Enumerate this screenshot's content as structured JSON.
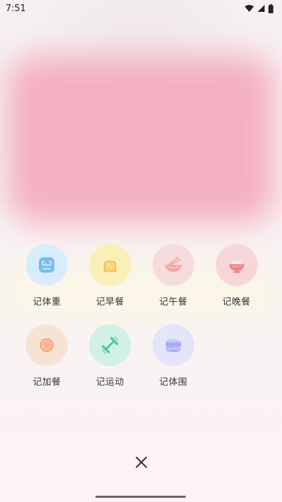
{
  "status_bar": {
    "time": "7:51",
    "icons": [
      "wifi-icon",
      "signal-icon",
      "battery-icon"
    ]
  },
  "actions": [
    {
      "label": "记体重",
      "icon": "scale-icon",
      "bg": "#d9ecfb",
      "color": "#6bb6ef"
    },
    {
      "label": "记早餐",
      "icon": "bread-icon",
      "bg": "#fbefb8",
      "color": "#f6c75c"
    },
    {
      "label": "记午餐",
      "icon": "noodle-bowl-icon",
      "bg": "#f7dcdd",
      "color": "#f2a3a4"
    },
    {
      "label": "记晚餐",
      "icon": "rice-bowl-icon",
      "bg": "#f6d6d8",
      "color": "#f28a8e"
    },
    {
      "label": "记加餐",
      "icon": "orange-slice-icon",
      "bg": "#f7e2d4",
      "color": "#f3a882"
    },
    {
      "label": "记运动",
      "icon": "dumbbell-icon",
      "bg": "#d2f0e6",
      "color": "#5fd1aa"
    },
    {
      "label": "记体围",
      "icon": "tape-measure-icon",
      "bg": "#e4e5fb",
      "color": "#a9abf2"
    }
  ],
  "close": {
    "icon": "close-icon"
  }
}
